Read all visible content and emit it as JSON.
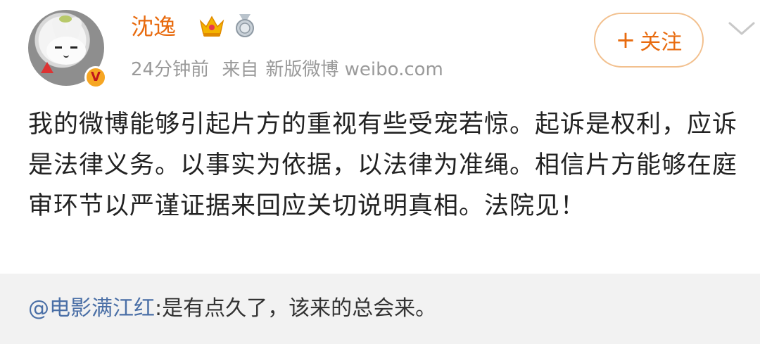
{
  "post": {
    "author": {
      "name": "沈逸",
      "verified_badge": "V",
      "avatar_icon": "rabbit-avatar-icon",
      "badges": [
        "crown-icon",
        "medal-icon"
      ]
    },
    "meta": {
      "time": "24分钟前",
      "source_prefix": "来自",
      "source": "新版微博 weibo.com"
    },
    "follow_button": {
      "plus": "+",
      "label": "关注"
    },
    "content": "我的微博能够引起片方的重视有些受宠若惊。起诉是权利，应诉是法律义务。以事实为依据，以法律为准绳。相信片方能够在庭审环节以严谨证据来回应关切说明真相。法院见！"
  },
  "repost": {
    "author": "@电影满江红",
    "text": ":是有点久了，该来的总会来。"
  },
  "colors": {
    "accent": "#e86b0f",
    "link": "#4a6fa6",
    "muted": "#9a9a9a",
    "repost_bg": "#f2f2f2"
  }
}
